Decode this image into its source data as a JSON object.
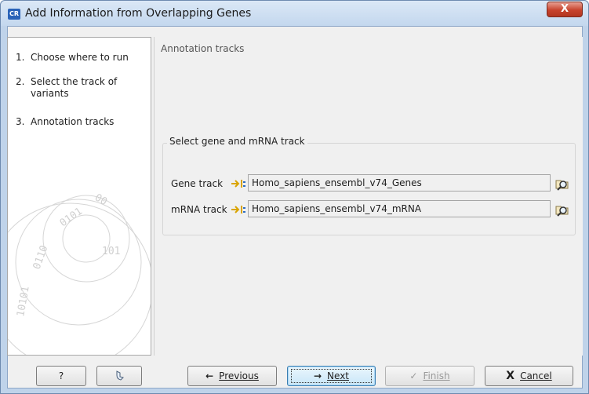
{
  "window": {
    "app_icon": "CR",
    "title": "Add Information from Overlapping Genes",
    "close_glyph": "X"
  },
  "steps": [
    {
      "num": "1.",
      "label": "Choose where to run"
    },
    {
      "num": "2.",
      "label": "Select the track of variants"
    },
    {
      "num": "3.",
      "label": "Annotation tracks"
    }
  ],
  "content": {
    "header": "Annotation tracks",
    "group_title": "Select gene and mRNA track",
    "gene_track_label": "Gene track",
    "gene_track_value": "Homo_sapiens_ensembl_v74_Genes",
    "mrna_track_label": "mRNA track",
    "mrna_track_value": "Homo_sapiens_ensembl_v74_mRNA"
  },
  "buttons": {
    "help": "?",
    "reset_icon": "reset-icon",
    "previous_arrow": "←",
    "previous": "Previous",
    "next_arrow": "→",
    "next": "Next",
    "finish_check": "✓",
    "finish": "Finish",
    "cancel_x": "X",
    "cancel": "Cancel"
  },
  "colors": {
    "titlebar": "#c3d7ee",
    "close_button": "#c7432d",
    "track_icon": "#d9a400"
  }
}
